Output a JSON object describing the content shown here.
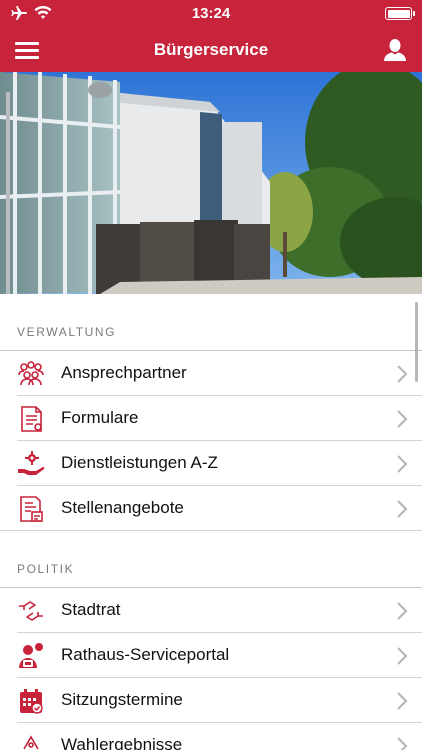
{
  "status_bar": {
    "time": "13:24",
    "left_icons": [
      "airplane-icon",
      "wifi-icon"
    ],
    "right_icons": [
      "battery-icon"
    ]
  },
  "nav": {
    "title": "Bürgerservice",
    "menu_icon": "hamburger-menu-icon",
    "user_icon": "user-icon"
  },
  "colors": {
    "brand": "#c7233b",
    "icon": "#c7233b",
    "chevron": "#b8b8bc",
    "section_header": "#7a7a7a"
  },
  "sections": [
    {
      "header": "VERWALTUNG",
      "items": [
        {
          "label": "Ansprechpartner",
          "icon": "people-group-icon"
        },
        {
          "label": "Formulare",
          "icon": "forms-document-icon"
        },
        {
          "label": "Dienstleistungen A-Z",
          "icon": "service-hand-gear-icon"
        },
        {
          "label": "Stellenangebote",
          "icon": "job-document-icon"
        }
      ]
    },
    {
      "header": "POLITIK",
      "items": [
        {
          "label": "Stadtrat",
          "icon": "handshake-icon"
        },
        {
          "label": "Rathaus-Serviceportal",
          "icon": "service-portal-icon"
        },
        {
          "label": "Sitzungstermine",
          "icon": "calendar-check-icon"
        },
        {
          "label": "Wahlergebnisse",
          "icon": "election-results-icon"
        }
      ]
    }
  ]
}
